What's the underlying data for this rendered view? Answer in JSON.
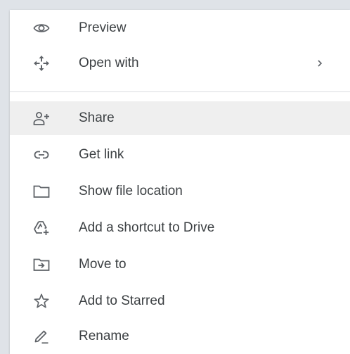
{
  "menu": {
    "items": [
      {
        "label": "Preview",
        "icon": "eye-icon"
      },
      {
        "label": "Open with",
        "icon": "open-with-icon",
        "submenu_indicator": "›"
      },
      {
        "label": "Share",
        "icon": "add-person-icon",
        "highlighted": true
      },
      {
        "label": "Get link",
        "icon": "link-icon"
      },
      {
        "label": "Show file location",
        "icon": "folder-icon"
      },
      {
        "label": "Add a shortcut to Drive",
        "icon": "drive-shortcut-icon"
      },
      {
        "label": "Move to",
        "icon": "move-to-folder-icon"
      },
      {
        "label": "Add to Starred",
        "icon": "star-icon"
      },
      {
        "label": "Rename",
        "icon": "pencil-icon"
      }
    ]
  },
  "colors": {
    "icon": "#5f6368",
    "text": "#3c4043",
    "highlight": "#efefef",
    "background": "#dfe3e8"
  }
}
